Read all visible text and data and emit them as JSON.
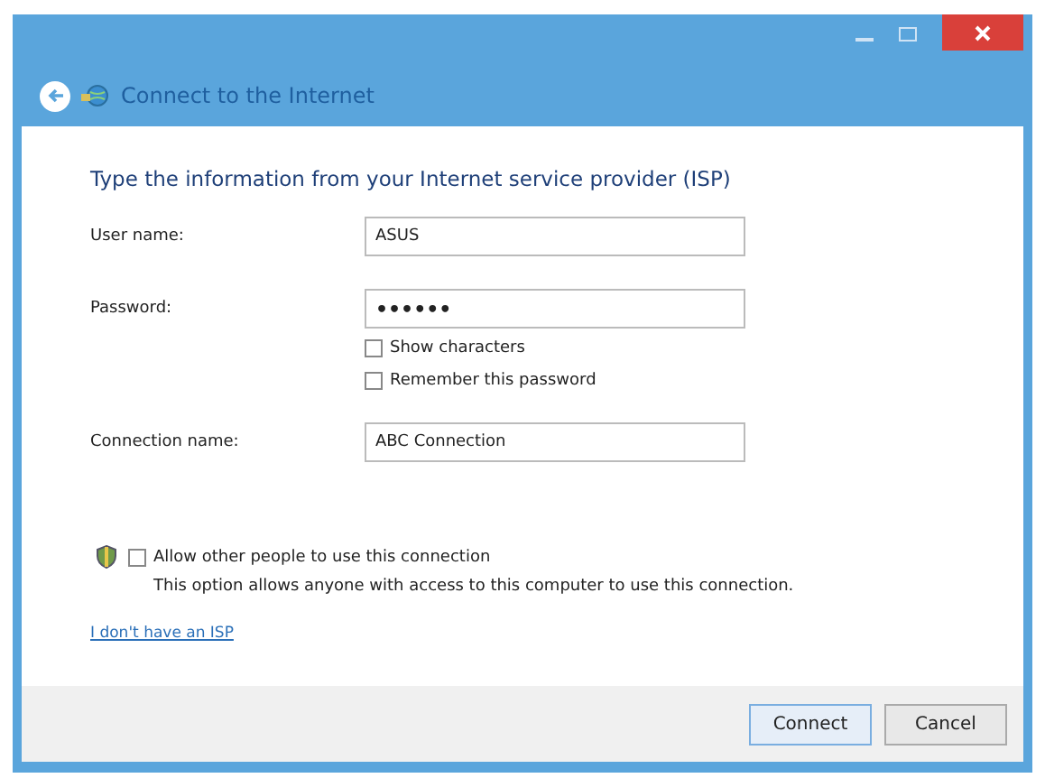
{
  "window": {
    "title": "Connect to the Internet"
  },
  "heading": "Type the information from your Internet service provider (ISP)",
  "fields": [
    {
      "label": "User name:",
      "value": "ASUS"
    },
    {
      "label": "Password:",
      "value": "••••••"
    }
  ],
  "password_options": [
    {
      "label": "Show characters",
      "checked": false
    },
    {
      "label": "Remember this password",
      "checked": false
    }
  ],
  "connection_name": {
    "label": "Connection name:",
    "value": "ABC Connection"
  },
  "allow_others": {
    "label": "Allow other people to use this connection",
    "checked": false,
    "description": "This option allows anyone with access to this computer to use this connection."
  },
  "link": "I don't have an ISP",
  "buttons": [
    {
      "label": "Connect",
      "kind": "default"
    },
    {
      "label": "Cancel",
      "kind": "normal"
    }
  ]
}
